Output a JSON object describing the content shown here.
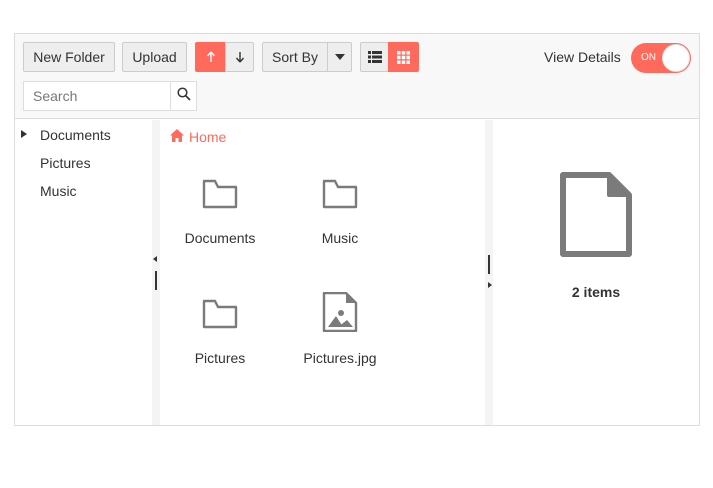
{
  "toolbar": {
    "new_folder_label": "New Folder",
    "upload_label": "Upload",
    "sort_ascending_icon": "arrow-up-icon",
    "sort_descending_icon": "arrow-down-icon",
    "sort_by_label": "Sort By",
    "list_view_icon": "list-view-icon",
    "grid_view_icon": "grid-view-icon",
    "view_details_label": "View Details",
    "view_details_state": "ON"
  },
  "search": {
    "placeholder": "Search",
    "value": ""
  },
  "navigation": {
    "items": [
      {
        "label": "Documents",
        "expandable": true
      },
      {
        "label": "Pictures",
        "expandable": false
      },
      {
        "label": "Music",
        "expandable": false
      }
    ]
  },
  "breadcrumb": {
    "home_label": "Home"
  },
  "files": [
    {
      "name": "Documents",
      "type": "folder",
      "icon": "folder-icon"
    },
    {
      "name": "Music",
      "type": "folder",
      "icon": "folder-icon"
    },
    {
      "name": "Pictures",
      "type": "folder",
      "icon": "folder-icon"
    },
    {
      "name": "Pictures.jpg",
      "type": "image",
      "icon": "image-file-icon"
    }
  ],
  "details": {
    "icon": "file-icon",
    "item_count_label": "2 items"
  },
  "colors": {
    "accent": "#ff6a5c",
    "toolbar_bg": "#f8f8f8",
    "icon_gray": "#7b7b7b",
    "border": "#dddddd"
  }
}
